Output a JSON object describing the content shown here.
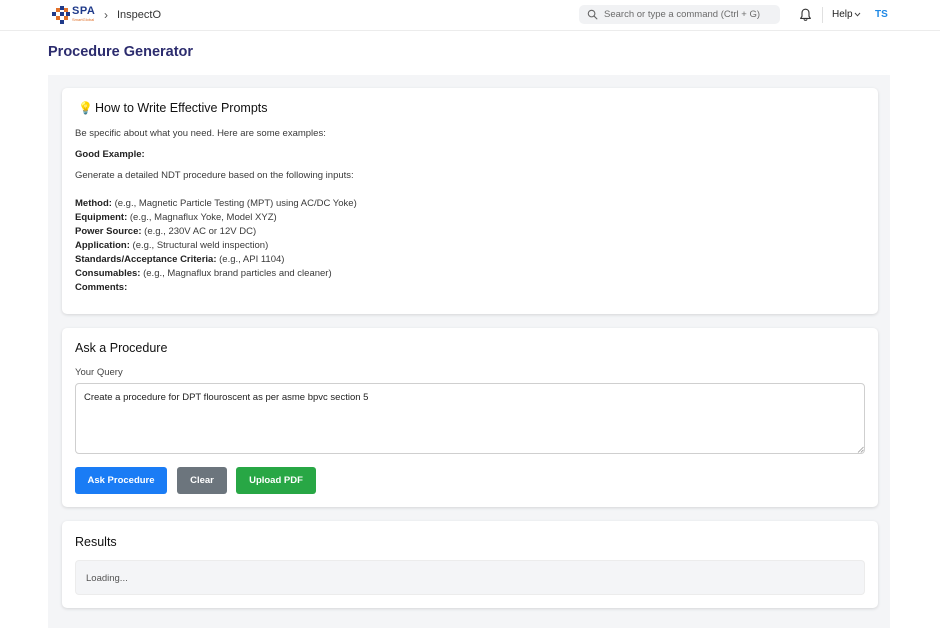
{
  "app": {
    "logo_text": "SPA",
    "logo_subtext": "SmartGlobal",
    "breadcrumb": {
      "separator": "›",
      "current": "InspectO"
    }
  },
  "header": {
    "search_placeholder": "Search or type a command (Ctrl + G)",
    "help_label": "Help",
    "user_initials": "TS",
    "icons": [
      "search-icon",
      "bell-icon",
      "chevron-down-icon"
    ]
  },
  "page": {
    "title": "Procedure Generator"
  },
  "tips": {
    "icon": "lightbulb-icon",
    "icon_glyph": "💡",
    "title": "How to Write Effective Prompts",
    "intro": "Be specific about what you need. Here are some examples:",
    "good_example_label": "Good Example:",
    "lead": "Generate a detailed NDT procedure based on the following inputs:",
    "fields": [
      {
        "label": "Method:",
        "example": " (e.g., Magnetic Particle Testing (MPT) using AC/DC Yoke)"
      },
      {
        "label": "Equipment:",
        "example": " (e.g., Magnaflux Yoke, Model XYZ)"
      },
      {
        "label": "Power Source:",
        "example": " (e.g., 230V AC or 12V DC)"
      },
      {
        "label": "Application:",
        "example": " (e.g., Structural weld inspection)"
      },
      {
        "label": "Standards/Acceptance Criteria:",
        "example": " (e.g., API 1104)"
      },
      {
        "label": "Consumables:",
        "example": " (e.g., Magnaflux brand particles and cleaner)"
      },
      {
        "label": "Comments:",
        "example": ""
      }
    ]
  },
  "query": {
    "title": "Ask a Procedure",
    "label": "Your Query",
    "value": "Create a procedure for DPT flouroscent as per asme bpvc section 5",
    "buttons": {
      "ask": "Ask Procedure",
      "clear": "Clear",
      "upload": "Upload PDF"
    }
  },
  "results": {
    "title": "Results",
    "status": "Loading..."
  },
  "colors": {
    "title": "#2c2c6e",
    "ask_button": "#1a7cf5",
    "clear_button": "#6c757d",
    "upload_button": "#28a745",
    "user_initials": "#1e88e5"
  }
}
